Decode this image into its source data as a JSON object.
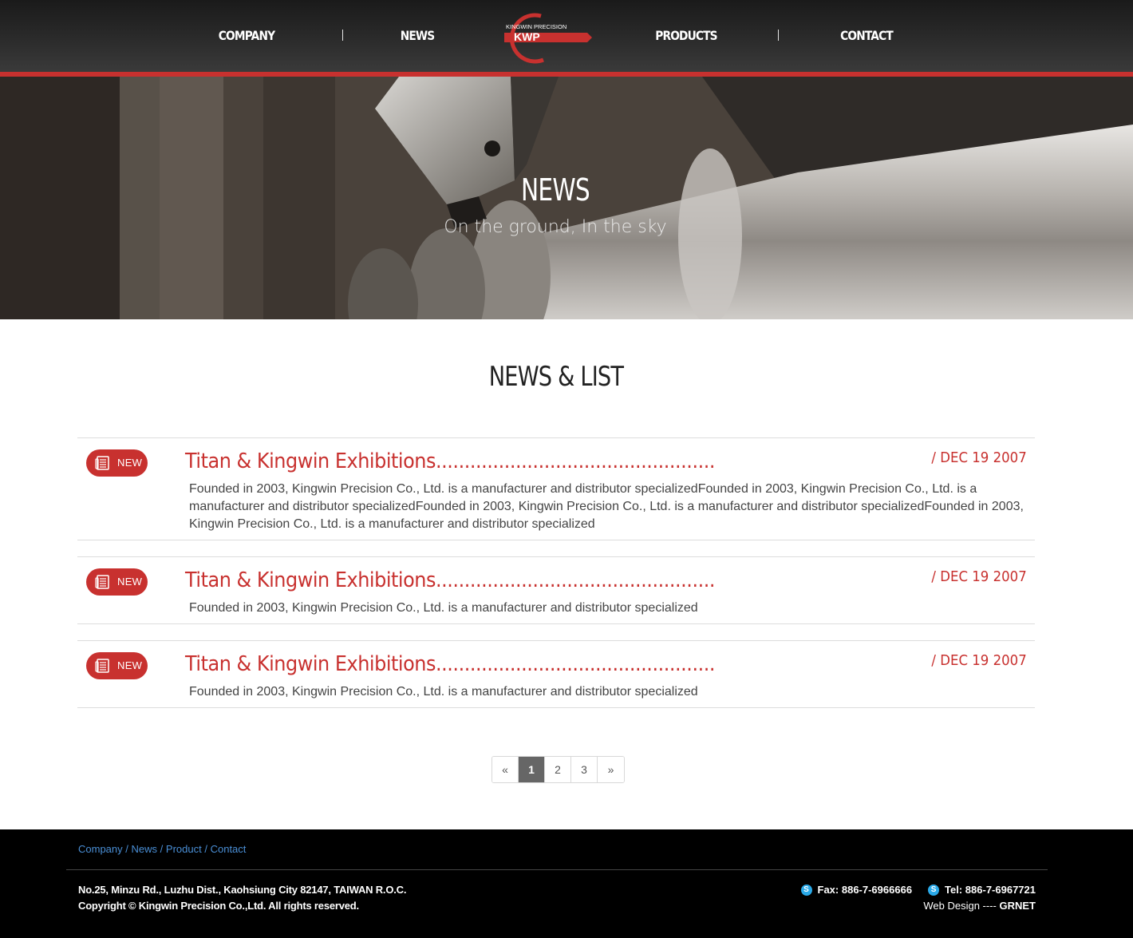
{
  "nav": {
    "items": [
      {
        "label": "COMPANY"
      },
      {
        "label": "NEWS"
      },
      {
        "label": "PRODUCTS"
      },
      {
        "label": "CONTACT"
      }
    ],
    "logo": {
      "text": "KWP",
      "tagline": "KINGWIN PRECISION"
    }
  },
  "hero": {
    "title": "NEWS",
    "subtitle": "On the ground, In the sky"
  },
  "section": {
    "title": "NEWS & LIST"
  },
  "news": [
    {
      "badge": "NEW",
      "title": "Titan & Kingwin Exhibitions.................................................",
      "date": "/ DEC 19 2007",
      "body": "Founded in 2003, Kingwin Precision Co., Ltd. is a manufacturer and distributor specializedFounded in 2003, Kingwin Precision Co., Ltd. is a manufacturer and distributor specializedFounded in 2003, Kingwin Precision Co., Ltd. is a manufacturer and distributor specializedFounded in 2003, Kingwin Precision Co., Ltd. is a manufacturer and distributor specialized"
    },
    {
      "badge": "NEW",
      "title": "Titan & Kingwin Exhibitions.................................................",
      "date": "/ DEC 19 2007",
      "body": "Founded in 2003, Kingwin Precision Co., Ltd. is a manufacturer and distributor specialized"
    },
    {
      "badge": "NEW",
      "title": "Titan & Kingwin Exhibitions.................................................",
      "date": "/ DEC 19 2007",
      "body": "Founded in 2003, Kingwin Precision Co., Ltd. is a manufacturer and distributor specialized"
    }
  ],
  "pagination": {
    "prev": "«",
    "pages": [
      "1",
      "2",
      "3"
    ],
    "current": "1",
    "next": "»"
  },
  "footer": {
    "links": [
      "Company",
      "News",
      "Product",
      "Contact"
    ],
    "separator": "/",
    "address": "No.25, Minzu Rd., Luzhu Dist., Kaohsiung City 82147, TAIWAN R.O.C.",
    "copyright": "Copyright © Kingwin Precision Co.,Ltd. All rights reserved.",
    "fax": "Fax: 886-7-6966666",
    "tel": "Tel: 886-7-6967721",
    "credit_prefix": "Web Design ---- ",
    "credit_name": "GRNET",
    "contact_icon": "skype-icon"
  },
  "colors": {
    "accent": "#c8312f",
    "link": "#4a8fd6",
    "footer_bg": "#000000",
    "header_bg": "#2b2b2b"
  }
}
